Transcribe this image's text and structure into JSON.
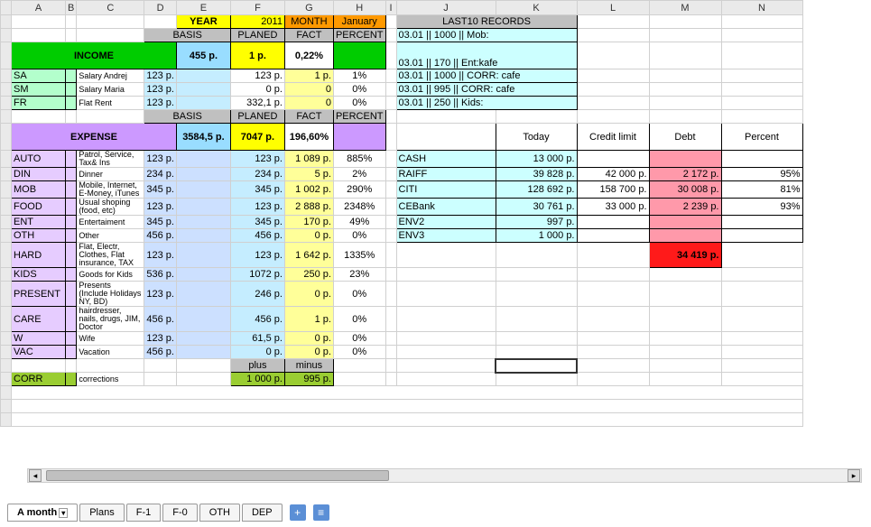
{
  "columns": [
    "A",
    "B",
    "C",
    "D",
    "E",
    "F",
    "G",
    "H",
    "I",
    "J",
    "K",
    "L",
    "M",
    "N"
  ],
  "header": {
    "year_label": "YEAR",
    "year_value": "2011",
    "month_label": "MONTH",
    "month_value": "January",
    "basis_label": "BASIS",
    "planed_label": "PLANED",
    "fact_label": "FACT",
    "percent_label": "PERCENT"
  },
  "income": {
    "title": "INCOME",
    "planed": "455 p.",
    "fact": "1 p.",
    "percent": "0,22%",
    "rows": [
      {
        "code": "SA",
        "desc": "Salary Andrej",
        "basis": "123 p.",
        "planed": "123 p.",
        "fact": "1 p.",
        "pct": "1%"
      },
      {
        "code": "SM",
        "desc": "Salary Maria",
        "basis": "123 p.",
        "planed": "0 p.",
        "fact": "0",
        "pct": "0%"
      },
      {
        "code": "FR",
        "desc": "Flat Rent",
        "basis": "123 p.",
        "planed": "332,1 p.",
        "fact": "0",
        "pct": "0%"
      }
    ]
  },
  "expense": {
    "title": "EXPENSE",
    "planed": "3584,5 p.",
    "fact": "7047 p.",
    "percent": "196,60%",
    "rows": [
      {
        "code": "AUTO",
        "desc": "Patrol, Service, Tax& Ins",
        "basis": "123 p.",
        "planed": "123 p.",
        "fact": "1 089 p.",
        "pct": "885%"
      },
      {
        "code": "DIN",
        "desc": "Dinner",
        "basis": "234 p.",
        "planed": "234 p.",
        "fact": "5 p.",
        "pct": "2%"
      },
      {
        "code": "MOB",
        "desc": "Mobile, Internet, E-Money, iTunes",
        "basis": "345 p.",
        "planed": "345 p.",
        "fact": "1 002 p.",
        "pct": "290%"
      },
      {
        "code": "FOOD",
        "desc": "Usual shoping (food, etc)",
        "basis": "123 p.",
        "planed": "123 p.",
        "fact": "2 888 p.",
        "pct": "2348%"
      },
      {
        "code": "ENT",
        "desc": "Entertaiment",
        "basis": "345 p.",
        "planed": "345 p.",
        "fact": "170 p.",
        "pct": "49%"
      },
      {
        "code": "OTH",
        "desc": "Other",
        "basis": "456 p.",
        "planed": "456 p.",
        "fact": "0 p.",
        "pct": "0%"
      },
      {
        "code": "HARD",
        "desc": "Flat, Electr, Clothes, Flat insurance, TAX",
        "basis": "123 p.",
        "planed": "123 p.",
        "fact": "1 642 p.",
        "pct": "1335%"
      },
      {
        "code": "KIDS",
        "desc": "Goods for Kids",
        "basis": "536 p.",
        "planed": "1072 p.",
        "fact": "250 p.",
        "pct": "23%"
      },
      {
        "code": "PRESENT",
        "desc": "Presents (Include Holidays NY, BD)",
        "basis": "123 p.",
        "planed": "246 p.",
        "fact": "0 p.",
        "pct": "0%"
      },
      {
        "code": "CARE",
        "desc": "hairdresser, nails, drugs, JIM, Doctor",
        "basis": "456 p.",
        "planed": "456 p.",
        "fact": "1 p.",
        "pct": "0%"
      },
      {
        "code": "W",
        "desc": "Wife",
        "basis": "123 p.",
        "planed": "61,5 p.",
        "fact": "0 p.",
        "pct": "0%"
      },
      {
        "code": "VAC",
        "desc": "Vacation",
        "basis": "456 p.",
        "planed": "0 p.",
        "fact": "0 p.",
        "pct": "0%"
      }
    ]
  },
  "corr": {
    "code": "CORR",
    "desc": "corrections",
    "plus_label": "plus",
    "minus_label": "minus",
    "plus": "1 000 p.",
    "minus": "995 p."
  },
  "records": {
    "title": "LAST10 RECORDS",
    "items": [
      "03.01 || 1000 || Mob:",
      "03.01 || 170 || Ent:kafe",
      "03.01 || 1000 || CORR: cafe",
      "03.01 || 995 || CORR: cafe",
      "03.01 || 250 || Kids:"
    ]
  },
  "balance": {
    "headers": {
      "today": "Today",
      "limit": "Credit limit",
      "debt": "Debt",
      "pct": "Percent"
    },
    "rows": [
      {
        "name": "CASH",
        "today": "13 000 p.",
        "limit": "",
        "debt": "",
        "pct": ""
      },
      {
        "name": "RAIFF",
        "today": "39 828 p.",
        "limit": "42 000 p.",
        "debt": "2 172 p.",
        "pct": "95%"
      },
      {
        "name": "CITI",
        "today": "128 692 p.",
        "limit": "158 700 p.",
        "debt": "30 008 p.",
        "pct": "81%"
      },
      {
        "name": "CEBank",
        "today": "30 761 p.",
        "limit": "33 000 p.",
        "debt": "2 239 p.",
        "pct": "93%"
      },
      {
        "name": "ENV2",
        "today": "997 p.",
        "limit": "",
        "debt": "",
        "pct": ""
      },
      {
        "name": "ENV3",
        "today": "1 000 p.",
        "limit": "",
        "debt": "",
        "pct": ""
      }
    ],
    "total_debt": "34 419 p."
  },
  "tabs": [
    "A month",
    "Plans",
    "F-1",
    "F-0",
    "OTH",
    "DEP"
  ]
}
